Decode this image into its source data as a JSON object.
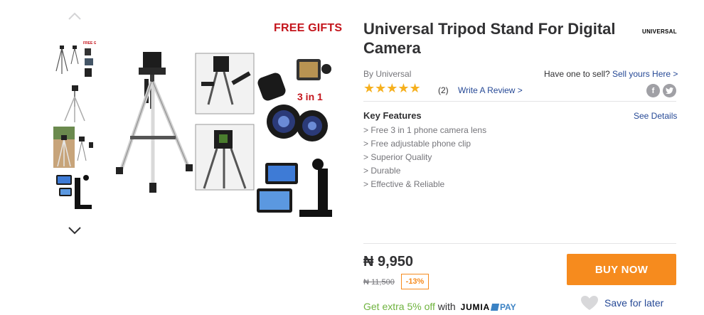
{
  "product": {
    "title": "Universal Tripod Stand For Digital Camera",
    "brand_logo_text": "UNIVERSAL",
    "by_brand": "By Universal",
    "sell": {
      "question": "Have one to sell?",
      "link": "Sell yours Here >"
    },
    "rating": {
      "stars": "★★★★★",
      "value": 5,
      "count": "(2)",
      "write_review": "Write A Review >"
    },
    "share_icons": [
      "facebook-icon",
      "twitter-icon"
    ]
  },
  "gallery": {
    "thumbnails": [
      "thumb-1",
      "thumb-2",
      "thumb-3",
      "thumb-4"
    ],
    "main_badge": "FREE GIFTS",
    "lens_label": "3 in 1"
  },
  "key_features": {
    "title": "Key Features",
    "see_details": "See Details",
    "items": [
      "> Free 3 in 1 phone camera lens",
      "> Free adjustable phone clip",
      "> Superior Quality",
      "> Durable",
      "> Effective & Reliable"
    ]
  },
  "pricing": {
    "price": "₦ 9,950",
    "old_price": "₦ 11,500",
    "discount": "-13%"
  },
  "actions": {
    "buy_now": "BUY NOW",
    "save_later": "Save for later"
  },
  "promo": {
    "green_text": "Get extra 5% off",
    "with_text": " with ",
    "jumia": "JUMIA",
    "pay": "PAY"
  },
  "colors": {
    "accent_orange": "#f68b1e",
    "link_blue": "#264996",
    "star_yellow": "#f6b01e",
    "promo_green": "#6fb33f",
    "gift_red": "#c4151c"
  }
}
